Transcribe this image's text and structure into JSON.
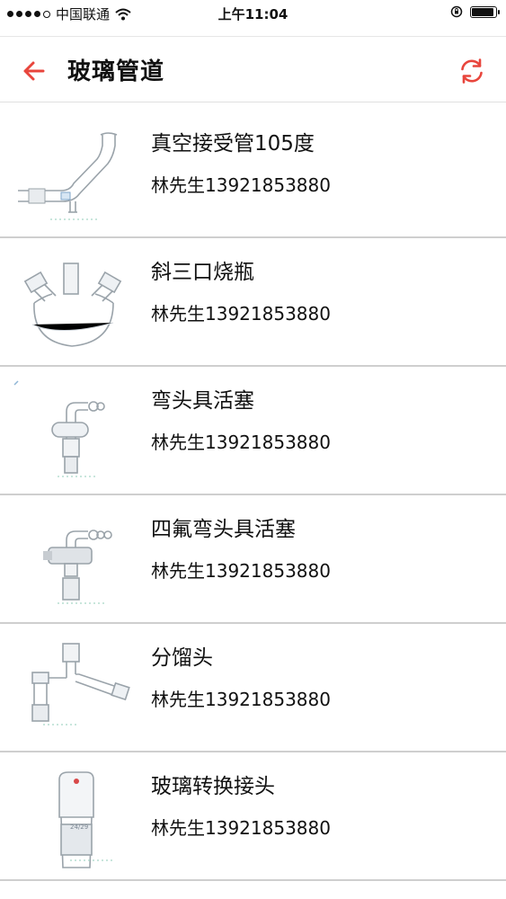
{
  "status_bar": {
    "carrier": "中国联通",
    "time": "上午11:04"
  },
  "header": {
    "title": "玻璃管道",
    "back_icon": "arrow-left-icon",
    "refresh_icon": "refresh-icon",
    "accent_color": "#e8453c"
  },
  "items": [
    {
      "title": "真空接受管105度",
      "contact": "林先生13921853880"
    },
    {
      "title": "斜三口烧瓶",
      "contact": "林先生13921853880"
    },
    {
      "title": "弯头具活塞",
      "contact": "林先生13921853880"
    },
    {
      "title": "四氟弯头具活塞",
      "contact": "林先生13921853880"
    },
    {
      "title": "分馏头",
      "contact": "林先生13921853880"
    },
    {
      "title": "玻璃转换接头",
      "contact": "林先生13921853880"
    }
  ]
}
